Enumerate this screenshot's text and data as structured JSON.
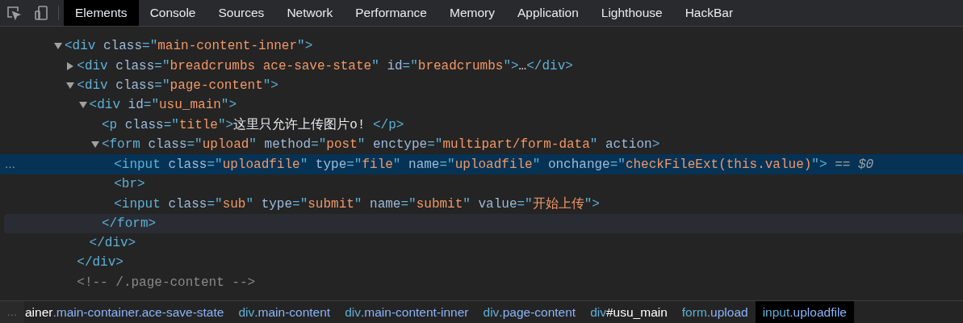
{
  "toolbar": {
    "tabs": [
      {
        "label": "Elements",
        "selected": true
      },
      {
        "label": "Console",
        "selected": false
      },
      {
        "label": "Sources",
        "selected": false
      },
      {
        "label": "Network",
        "selected": false
      },
      {
        "label": "Performance",
        "selected": false
      },
      {
        "label": "Memory",
        "selected": false
      },
      {
        "label": "Application",
        "selected": false
      },
      {
        "label": "Lighthouse",
        "selected": false
      },
      {
        "label": "HackBar",
        "selected": false
      }
    ]
  },
  "dom_tree": {
    "nodes": [
      {
        "expanded": true,
        "selected": false,
        "hovered": false,
        "tokens": [
          {
            "kind": "tag",
            "text": "<div "
          },
          {
            "kind": "attr",
            "text": "class"
          },
          {
            "kind": "tag",
            "text": "=\""
          },
          {
            "kind": "value",
            "text": "main-content-inner"
          },
          {
            "kind": "tag",
            "text": "\">"
          }
        ],
        "children": [
          {
            "expanded": false,
            "selected": false,
            "hovered": false,
            "tokens": [
              {
                "kind": "tag",
                "text": "<div "
              },
              {
                "kind": "attr",
                "text": "class"
              },
              {
                "kind": "tag",
                "text": "=\""
              },
              {
                "kind": "value",
                "text": "breadcrumbs ace-save-state"
              },
              {
                "kind": "tag",
                "text": "\" "
              },
              {
                "kind": "attr",
                "text": "id"
              },
              {
                "kind": "tag",
                "text": "=\""
              },
              {
                "kind": "value",
                "text": "breadcrumbs"
              },
              {
                "kind": "tag",
                "text": "\">"
              },
              {
                "kind": "text",
                "text": "…"
              },
              {
                "kind": "tag",
                "text": "</div>"
              }
            ]
          },
          {
            "expanded": true,
            "selected": false,
            "hovered": false,
            "tokens": [
              {
                "kind": "tag",
                "text": "<div "
              },
              {
                "kind": "attr",
                "text": "class"
              },
              {
                "kind": "tag",
                "text": "=\""
              },
              {
                "kind": "value",
                "text": "page-content"
              },
              {
                "kind": "tag",
                "text": "\">"
              }
            ],
            "children": [
              {
                "expanded": true,
                "selected": false,
                "hovered": false,
                "tokens": [
                  {
                    "kind": "tag",
                    "text": "<div "
                  },
                  {
                    "kind": "attr",
                    "text": "id"
                  },
                  {
                    "kind": "tag",
                    "text": "=\""
                  },
                  {
                    "kind": "value",
                    "text": "usu_main"
                  },
                  {
                    "kind": "tag",
                    "text": "\">"
                  }
                ],
                "children": [
                  {
                    "selected": false,
                    "hovered": false,
                    "tokens": [
                      {
                        "kind": "tag",
                        "text": "<p "
                      },
                      {
                        "kind": "attr",
                        "text": "class"
                      },
                      {
                        "kind": "tag",
                        "text": "=\""
                      },
                      {
                        "kind": "value",
                        "text": "title"
                      },
                      {
                        "kind": "tag",
                        "text": "\">"
                      },
                      {
                        "kind": "text",
                        "text": "这里只允许上传图片o! "
                      },
                      {
                        "kind": "tag",
                        "text": "</p>"
                      }
                    ]
                  },
                  {
                    "expanded": true,
                    "selected": false,
                    "hovered": false,
                    "tokens": [
                      {
                        "kind": "tag",
                        "text": "<form "
                      },
                      {
                        "kind": "attr",
                        "text": "class"
                      },
                      {
                        "kind": "tag",
                        "text": "=\""
                      },
                      {
                        "kind": "value",
                        "text": "upload"
                      },
                      {
                        "kind": "tag",
                        "text": "\" "
                      },
                      {
                        "kind": "attr",
                        "text": "method"
                      },
                      {
                        "kind": "tag",
                        "text": "=\""
                      },
                      {
                        "kind": "value",
                        "text": "post"
                      },
                      {
                        "kind": "tag",
                        "text": "\" "
                      },
                      {
                        "kind": "attr",
                        "text": "enctype"
                      },
                      {
                        "kind": "tag",
                        "text": "=\""
                      },
                      {
                        "kind": "value",
                        "text": "multipart/form-data"
                      },
                      {
                        "kind": "tag",
                        "text": "\" "
                      },
                      {
                        "kind": "attr",
                        "text": "action"
                      },
                      {
                        "kind": "tag",
                        "text": ">"
                      }
                    ],
                    "children": [
                      {
                        "selected": true,
                        "hovered": false,
                        "marker": "…",
                        "tokens": [
                          {
                            "kind": "tag",
                            "text": "<input "
                          },
                          {
                            "kind": "attr",
                            "text": "class"
                          },
                          {
                            "kind": "tag",
                            "text": "=\""
                          },
                          {
                            "kind": "value",
                            "text": "uploadfile"
                          },
                          {
                            "kind": "tag",
                            "text": "\" "
                          },
                          {
                            "kind": "attr",
                            "text": "type"
                          },
                          {
                            "kind": "tag",
                            "text": "=\""
                          },
                          {
                            "kind": "value",
                            "text": "file"
                          },
                          {
                            "kind": "tag",
                            "text": "\" "
                          },
                          {
                            "kind": "attr",
                            "text": "name"
                          },
                          {
                            "kind": "tag",
                            "text": "=\""
                          },
                          {
                            "kind": "value",
                            "text": "uploadfile"
                          },
                          {
                            "kind": "tag",
                            "text": "\" "
                          },
                          {
                            "kind": "attr",
                            "text": "onchange"
                          },
                          {
                            "kind": "tag",
                            "text": "=\""
                          },
                          {
                            "kind": "value",
                            "text": "checkFileExt(this.value)"
                          },
                          {
                            "kind": "tag",
                            "text": "\">"
                          },
                          {
                            "kind": "ref",
                            "text": " == $0"
                          }
                        ]
                      },
                      {
                        "selected": false,
                        "hovered": false,
                        "tokens": [
                          {
                            "kind": "tag",
                            "text": "<br>"
                          }
                        ]
                      },
                      {
                        "selected": false,
                        "hovered": false,
                        "tokens": [
                          {
                            "kind": "tag",
                            "text": "<input "
                          },
                          {
                            "kind": "attr",
                            "text": "class"
                          },
                          {
                            "kind": "tag",
                            "text": "=\""
                          },
                          {
                            "kind": "value",
                            "text": "sub"
                          },
                          {
                            "kind": "tag",
                            "text": "\" "
                          },
                          {
                            "kind": "attr",
                            "text": "type"
                          },
                          {
                            "kind": "tag",
                            "text": "=\""
                          },
                          {
                            "kind": "value",
                            "text": "submit"
                          },
                          {
                            "kind": "tag",
                            "text": "\" "
                          },
                          {
                            "kind": "attr",
                            "text": "name"
                          },
                          {
                            "kind": "tag",
                            "text": "=\""
                          },
                          {
                            "kind": "value",
                            "text": "submit"
                          },
                          {
                            "kind": "tag",
                            "text": "\" "
                          },
                          {
                            "kind": "attr",
                            "text": "value"
                          },
                          {
                            "kind": "tag",
                            "text": "=\""
                          },
                          {
                            "kind": "value",
                            "text": "开始上传"
                          },
                          {
                            "kind": "tag",
                            "text": "\">"
                          }
                        ]
                      }
                    ]
                  },
                  {
                    "selected": false,
                    "hovered": true,
                    "tokens": [
                      {
                        "kind": "tag",
                        "text": "</form>"
                      }
                    ]
                  }
                ]
              },
              {
                "selected": false,
                "hovered": false,
                "tokens": [
                  {
                    "kind": "tag",
                    "text": "</div>"
                  }
                ]
              }
            ]
          },
          {
            "selected": false,
            "hovered": false,
            "tokens": [
              {
                "kind": "tag",
                "text": "</div>"
              }
            ]
          },
          {
            "selected": false,
            "hovered": false,
            "tokens": [
              {
                "kind": "comment",
                "text": "<!-- /.page-content -->"
              }
            ]
          }
        ]
      }
    ]
  },
  "breadcrumbs": {
    "overflow": "…",
    "items": [
      {
        "selected": false,
        "parts": [
          {
            "kind": "plain",
            "text": "ainer"
          },
          {
            "kind": "class",
            "text": ".main-container.ace-save-state"
          }
        ]
      },
      {
        "selected": false,
        "parts": [
          {
            "kind": "tag",
            "text": "div"
          },
          {
            "kind": "class",
            "text": ".main-content"
          }
        ]
      },
      {
        "selected": false,
        "parts": [
          {
            "kind": "tag",
            "text": "div"
          },
          {
            "kind": "class",
            "text": ".main-content-inner"
          }
        ]
      },
      {
        "selected": false,
        "parts": [
          {
            "kind": "tag",
            "text": "div"
          },
          {
            "kind": "class",
            "text": ".page-content"
          }
        ]
      },
      {
        "selected": false,
        "parts": [
          {
            "kind": "tag",
            "text": "div"
          },
          {
            "kind": "plain",
            "text": "#usu_main"
          }
        ]
      },
      {
        "selected": false,
        "parts": [
          {
            "kind": "tag",
            "text": "form"
          },
          {
            "kind": "class",
            "text": ".upload"
          }
        ]
      },
      {
        "selected": true,
        "parts": [
          {
            "kind": "tag",
            "text": "input"
          },
          {
            "kind": "class",
            "text": ".uploadfile"
          }
        ]
      }
    ]
  }
}
